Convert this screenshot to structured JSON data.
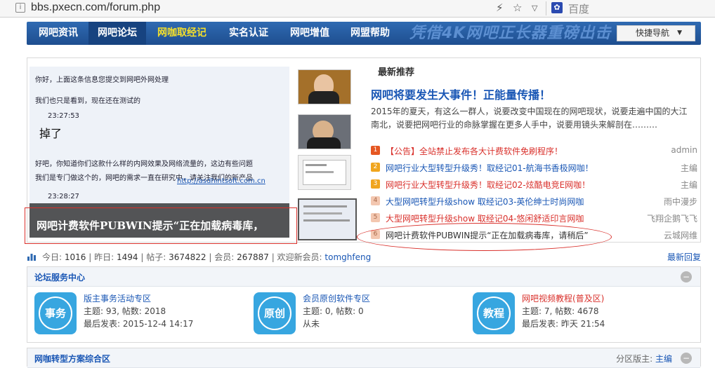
{
  "browser": {
    "url": "bbs.pxecn.com/forum.php",
    "search_engine": "百度"
  },
  "nav": {
    "items": [
      "网吧资讯",
      "网吧论坛",
      "网咖取经记",
      "实名认证",
      "网吧增值",
      "网盟帮助"
    ],
    "banner": "凭借4K网吧正长器重磅出击",
    "quick_nav": "快捷导航"
  },
  "slideshow": {
    "caption": "网吧计费软件PUBWIN提示“正在加载病毒库，",
    "chat": [
      "你好，上面这条信息您提交到网吧外网处理",
      "我们也只是看到，现在还在测试的",
      "23:27:53",
      "好吧，你知道你们这款什么样的内网效果及网络流量的，这边有些问题",
      "我们是专门做这个的，网吧的需求一直在研究中，请关注我们的新产品",
      "http://asdhintsoft.com.cn",
      "23:28:27"
    ],
    "big_text": "掉了"
  },
  "recommend": {
    "heading": "最新推荐",
    "headline": "网吧将要发生大事件！正能量传播！",
    "summary": "2015年的夏天，有这么一群人，说要改变中国现在的网吧现状，说要走遍中国的大江南北，说要把网吧行业的命脉掌握在更多人手中，说要用镜头来解剖在………",
    "rows": [
      {
        "num": "1",
        "title": "【公告】全站禁止发布各大计费软件免刷程序！",
        "author": "admin"
      },
      {
        "num": "2",
        "title": "网吧行业大型转型升级秀！取经记01-航海书香极网咖！",
        "author": "主编"
      },
      {
        "num": "3",
        "title": "网吧行业大型转型升级秀！取经记02-炫酷电竞E网咖！",
        "author": "主编"
      },
      {
        "num": "4",
        "title": "大型网吧转型升级show 取经记03-英伦绅士时尚网咖",
        "author": "雨中漫步"
      },
      {
        "num": "5",
        "title": "大型网吧转型升级show 取经记04-悠闲舒适印言网咖",
        "author": "飞翔企鹅飞飞"
      },
      {
        "num": "6",
        "title": "网吧计费软件PUBWIN提示“正在加载病毒库，请稍后”",
        "author": "云城网维"
      }
    ]
  },
  "stats": {
    "today_label": "今日:",
    "today": "1016",
    "yesterday_label": "昨日:",
    "yesterday": "1494",
    "posts_label": "帖子:",
    "posts": "3674822",
    "members_label": "会员:",
    "members": "267887",
    "welcome_label": "欢迎新会员:",
    "new_member": "tomghfeng",
    "latest_reply": "最新回复"
  },
  "service": {
    "title": "论坛服务中心",
    "forums": [
      {
        "badge": "事务",
        "name": "版主事务活动专区",
        "topics_line": "主题: 93, 帖数: 2018",
        "last_line": "最后发表: 2015-12-4 14:17"
      },
      {
        "badge": "原创",
        "name": "会员原创软件专区",
        "topics_line": "主题: 0, 帖数: 0",
        "last_line": "从未"
      },
      {
        "badge": "教程",
        "name": "网吧视频教程(普及区)",
        "topics_line": "主题: 7, 帖数: 4678",
        "last_line": "最后发表: 昨天 21:54"
      }
    ]
  },
  "transform": {
    "title": "网咖转型方案综合区",
    "moderator_label": "分区版主:",
    "moderator": "主编"
  },
  "colors": {
    "num_red": "#e55722",
    "num_orange": "#f0a51e",
    "num_gray": "#f3c7b0",
    "link_blue": "#1a57b5",
    "alert_red": "#d9302b"
  }
}
